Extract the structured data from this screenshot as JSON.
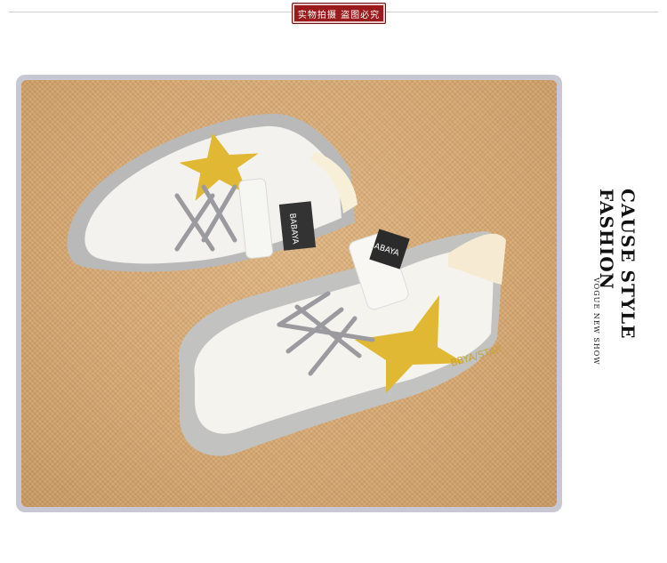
{
  "badge": {
    "text": "实物拍摄 盗图必究"
  },
  "side_text": {
    "line1": "CAUSE STYLE",
    "line2": "FASHION",
    "line3": "VOGUE NEW SHOW"
  },
  "shoe": {
    "tongue_label": "BABAYA",
    "side_label": "BBYA/STAR"
  },
  "colors": {
    "badge": "#9b1b1d",
    "carpet": "#d8aa74",
    "shoe_upper": "#f3f1ec",
    "star": "#e1b833",
    "laces": "#9a9a9f",
    "sole": "#bdbdbd"
  }
}
